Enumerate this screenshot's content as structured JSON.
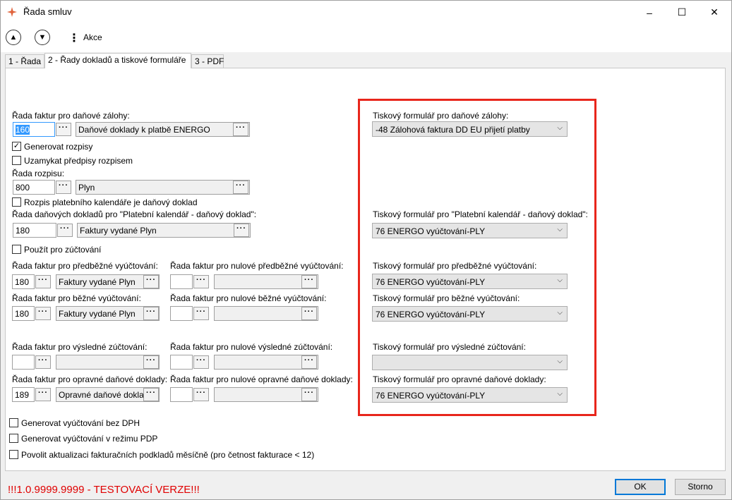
{
  "window": {
    "title": "Řada smluv",
    "minimize": "–",
    "maximize": "☐",
    "close": "✕"
  },
  "toolbar": {
    "up": "▲",
    "down": "▼",
    "menu": "⋮",
    "actions_label": "Akce"
  },
  "tabs": [
    {
      "label": "1 - Řada"
    },
    {
      "label": "2 - Řady dokladů a tiskové formuláře"
    },
    {
      "label": "3 - PDF"
    }
  ],
  "icons": {
    "ellipsis": "···",
    "check": "✓",
    "dropdown": "⌵"
  },
  "left": {
    "advance_invoice_series": {
      "label": "Řada faktur pro daňové zálohy:",
      "code": "160",
      "name": "Daňové doklady k platbě ENERGO"
    },
    "generate_breakdowns": {
      "label": "Generovat rozpisy",
      "checked": true
    },
    "lock_breakdowns": {
      "label": "Uzamykat předpisy rozpisem",
      "checked": false
    },
    "breakdown_series": {
      "label": "Řada rozpisu:",
      "code": "800",
      "name": "Plyn"
    },
    "payment_calendar_tax_doc": {
      "label": "Rozpis platebního kalendáře je daňový doklad",
      "checked": false
    },
    "tax_doc_series": {
      "label": "Řada daňových dokladů pro \"Platební kalendář - daňový doklad\":",
      "code": "180",
      "name": "Faktury vydané Plyn"
    },
    "use_for_billing": {
      "label": "Použít pro zúčtování",
      "checked": false
    },
    "prelim_billing": {
      "label": "Řada faktur pro předběžné vyúčtování:",
      "code": "180",
      "name": "Faktury vydané Plyn"
    },
    "zero_prelim_billing": {
      "label": "Řada faktur pro nulové předběžné vyúčtování:",
      "code": "",
      "name": ""
    },
    "regular_billing": {
      "label": "Řada faktur pro běžné vyúčtování:",
      "code": "180",
      "name": "Faktury vydané Plyn"
    },
    "zero_regular_billing": {
      "label": "Řada faktur pro nulové běžné vyúčtování:",
      "code": "",
      "name": ""
    },
    "final_settlement": {
      "label": "Řada faktur pro výsledné zúčtování:",
      "code": "",
      "name": ""
    },
    "zero_final_settlement": {
      "label": "Řada faktur pro nulové výsledné zúčtování:",
      "code": "",
      "name": ""
    },
    "corrective_docs": {
      "label": "Řada faktur pro opravné daňové doklady:",
      "code": "189",
      "name": "Opravné daňové dokla"
    },
    "zero_corrective_docs": {
      "label": "Řada faktur pro nulové opravné daňové doklady:",
      "code": "",
      "name": ""
    },
    "billing_no_vat": {
      "label": "Generovat vyúčtování bez DPH",
      "checked": false
    },
    "billing_pdp": {
      "label": "Generovat vyúčtování v režimu PDP",
      "checked": false
    },
    "monthly_update": {
      "label": "Povolit aktualizaci fakturačních podkladů měsíčně (pro četnost fakturace < 12)",
      "checked": false
    }
  },
  "right": {
    "advance_form": {
      "label": "Tiskový formulář pro daňové zálohy:",
      "value": "-48 Zálohová faktura DD EU přijetí platby"
    },
    "calendar_form": {
      "label": "Tiskový formulář pro \"Platební kalendář - daňový doklad\":",
      "value": "76 ENERGO vyúčtování-PLY"
    },
    "prelim_form": {
      "label": "Tiskový formulář pro předběžné vyúčtování:",
      "value": "76 ENERGO vyúčtování-PLY"
    },
    "regular_form": {
      "label": "Tiskový formulář pro běžné vyúčtování:",
      "value": "76 ENERGO vyúčtování-PLY"
    },
    "final_form": {
      "label": "Tiskový formulář pro výsledné zúčtování:",
      "value": ""
    },
    "corrective_form": {
      "label": "Tiskový formulář pro opravné daňové doklady:",
      "value": "76 ENERGO vyúčtování-PLY"
    }
  },
  "footer": {
    "version": "!!!1.0.9999.9999 - TESTOVACÍ VERZE!!!",
    "ok": "OK",
    "cancel": "Storno"
  },
  "colors": {
    "highlight_box": "#e8261c",
    "version_text": "#e00000",
    "selection": "#3399ff"
  }
}
